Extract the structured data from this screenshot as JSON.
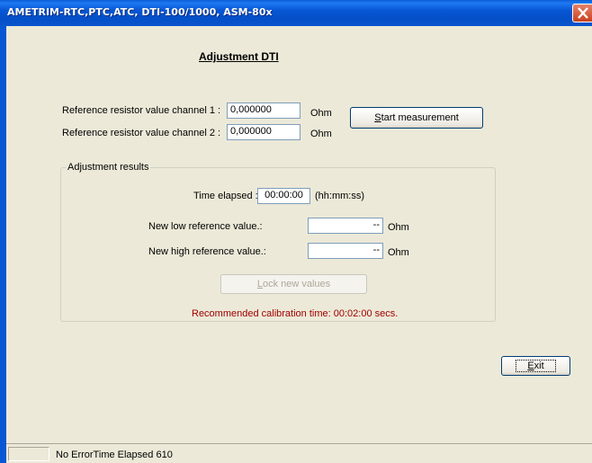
{
  "window": {
    "title": "AMETRIM-RTC,PTC,ATC, DTI-100/1000, ASM-80x",
    "close_glyph": "✕"
  },
  "heading": "Adjustment DTI",
  "reference": {
    "channel1_label": "Reference resistor value channel 1 :",
    "channel1_value": "0,000000",
    "channel2_label": "Reference resistor value channel 2 :",
    "channel2_value": "0,000000",
    "unit": "Ohm"
  },
  "start_button": {
    "prefix": "",
    "accel": "S",
    "rest": "tart measurement"
  },
  "results": {
    "group_title": "Adjustment results",
    "time_label": "Time elapsed :",
    "time_value": "00:00:00",
    "time_format": "(hh:mm:ss)",
    "low_label": "New low reference value.:",
    "low_value": "--",
    "high_label": "New high reference value.:",
    "high_value": "--",
    "unit": "Ohm",
    "lock_button": {
      "accel": "L",
      "rest": "ock new values"
    },
    "recommended": "Recommended calibration time: 00:02:00 secs."
  },
  "exit_button": {
    "accel": "E",
    "rest": "xit"
  },
  "statusbar": {
    "pane1": "",
    "text": "No ErrorTime Elapsed 610"
  },
  "colors": {
    "titlebar": "#0756d4",
    "face": "#ece9d8",
    "recommended_text": "#a00000",
    "close_button": "#c8401f"
  }
}
